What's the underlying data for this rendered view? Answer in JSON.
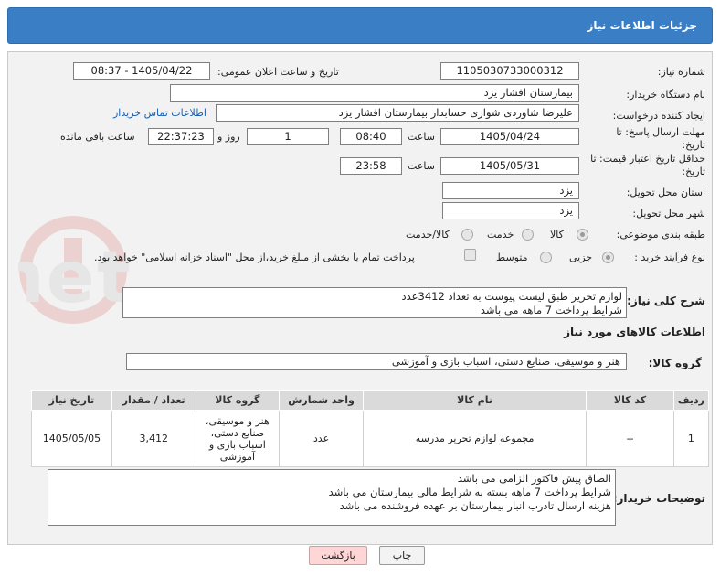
{
  "header": {
    "title": "جزئیات اطلاعات نیاز"
  },
  "fields": {
    "need_number_label": "شماره نیاز:",
    "need_number": "1105030733000312",
    "announce_datetime_label": "تاریخ و ساعت اعلان عمومی:",
    "announce_datetime": "1405/04/22 - 08:37",
    "buyer_org_label": "نام دستگاه خریدار:",
    "buyer_org": "بیمارستان افشار یزد",
    "creator_label": "ایجاد کننده درخواست:",
    "creator": "علیرضا شاوردی شوازی حسابدار بیمارستان افشار یزد",
    "buyer_contact_link": "اطلاعات تماس خریدار",
    "deadline_label": "مهلت ارسال پاسخ: تا تاریخ:",
    "deadline_date": "1405/04/24",
    "time_label": "ساعت",
    "deadline_time": "08:40",
    "days_value": "1",
    "days_label": "روز و",
    "remaining_time": "22:37:23",
    "remaining_label": "ساعت باقی مانده",
    "price_validity_label": "حداقل تاریخ اعتبار قیمت: تا تاریخ:",
    "price_validity_date": "1405/05/31",
    "price_validity_time": "23:58",
    "province_label": "استان محل تحویل:",
    "province": "یزد",
    "city_label": "شهر محل تحویل:",
    "city": "یزد",
    "category_label": "طبقه بندی موضوعی:",
    "category_options": [
      "کالا",
      "خدمت",
      "کالا/خدمت"
    ],
    "process_label": "نوع فرآیند خرید :",
    "process_options": [
      "جزیی",
      "متوسط"
    ],
    "payment_note": "پرداخت تمام یا بخشی از مبلغ خرید،از محل \"اسناد خزانه اسلامی\" خواهد بود."
  },
  "summary": {
    "label": "شرح کلی نیاز:",
    "line1": "لوازم تحریر طبق لیست پیوست به تعداد 3412عدد",
    "line2": "شرایط پرداخت 7 ماهه می باشد"
  },
  "goods_info_title": "اطلاعات کالاهای مورد نیاز",
  "goods_group": {
    "label": "گروه کالا:",
    "value": "هنر و موسیقی، صنایع دستی، اسباب بازی و آموزشی"
  },
  "table": {
    "headers": [
      "ردیف",
      "کد کالا",
      "نام کالا",
      "واحد شمارش",
      "گروه کالا",
      "تعداد / مقدار",
      "تاریخ نیاز"
    ],
    "rows": [
      [
        "1",
        "--",
        "مجموعه لوازم تحریر مدرسه",
        "عدد",
        "هنر و موسیقی، صنایع دستی، اسباب بازی و آموزشی",
        "3,412",
        "1405/05/05"
      ]
    ]
  },
  "buyer_notes": {
    "label": "توضیحات خریدار:",
    "line1": "الصاق پیش فاکتور الزامی می باشد",
    "line2": "شرایط پرداخت 7 ماهه بسته به شرایط مالی بیمارستان می باشد",
    "line3": "هزینه ارسال تادرب انبار بیمارستان بر عهده فروشنده می باشد"
  },
  "buttons": {
    "print": "چاپ",
    "back": "بازگشت"
  },
  "colors": {
    "header": "#3a7fc5",
    "link": "#1a5fb4",
    "back_button": "#ffd6d6",
    "panel": "#f2f2f2"
  }
}
